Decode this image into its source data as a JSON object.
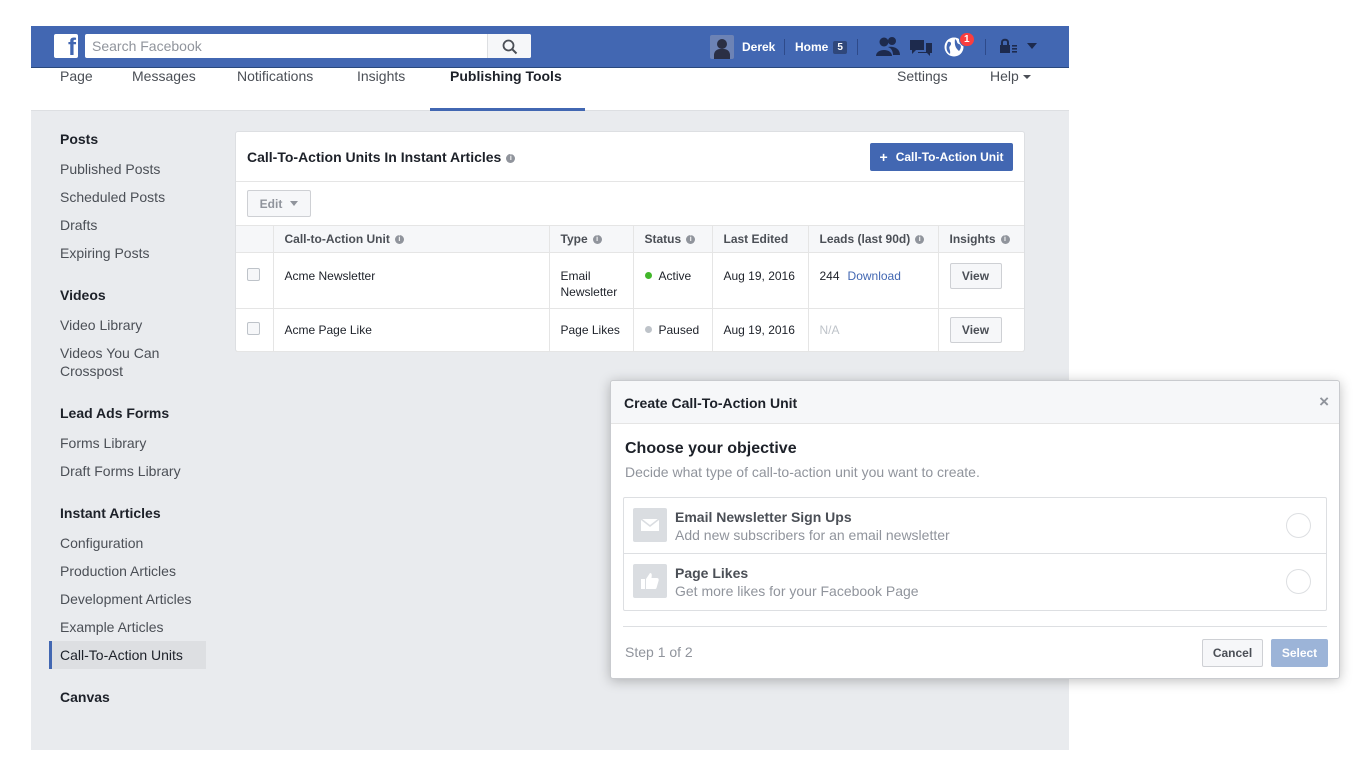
{
  "topbar": {
    "search_placeholder": "Search Facebook",
    "profile_name": "Derek",
    "home_label": "Home",
    "home_count": "5",
    "notifications_count": "1",
    "logo_letter": "f",
    "icons": [
      "facebook-logo",
      "search-icon",
      "friend-requests-icon",
      "messages-icon",
      "notifications-globe-icon",
      "privacy-shortcuts-icon",
      "account-menu-caret-icon"
    ]
  },
  "page_nav": {
    "tabs": [
      {
        "label": "Page"
      },
      {
        "label": "Messages"
      },
      {
        "label": "Notifications"
      },
      {
        "label": "Insights"
      },
      {
        "label": "Publishing Tools",
        "active": true
      }
    ],
    "right": [
      {
        "label": "Settings"
      },
      {
        "label": "Help"
      }
    ]
  },
  "sidebar": {
    "sections": [
      {
        "heading": "Posts",
        "items": [
          "Published Posts",
          "Scheduled Posts",
          "Drafts",
          "Expiring Posts"
        ]
      },
      {
        "heading": "Videos",
        "items": [
          "Video Library",
          "Videos You Can",
          "Crosspost"
        ]
      },
      {
        "heading": "Lead Ads Forms",
        "items": [
          "Forms Library",
          "Draft Forms Library"
        ]
      },
      {
        "heading": "Instant Articles",
        "items": [
          "Configuration",
          "Production Articles",
          "Development Articles",
          "Example Articles",
          "Call-To-Action Units"
        ]
      },
      {
        "heading": "Canvas",
        "items": []
      }
    ],
    "active_item": "Call-To-Action Units"
  },
  "panel": {
    "title": "Call-To-Action Units In Instant Articles",
    "add_button": "Call-To-Action Unit",
    "add_plus": "+",
    "edit_button": "Edit",
    "info_glyph": "i",
    "columns": [
      "Call-to-Action Unit",
      "Type",
      "Status",
      "Last Edited",
      "Leads (last 90d)",
      "Insights"
    ],
    "rows": [
      {
        "name": "Acme Newsletter",
        "type_line1": "Email",
        "type_line2": "Newsletter",
        "status": "Active",
        "status_color": "#42b72a",
        "last_edited": "Aug 19, 2016",
        "leads": "244",
        "leads_link": "Download",
        "insights_button": "View"
      },
      {
        "name": "Acme Page Like",
        "type_line1": "Page Likes",
        "type_line2": "",
        "status": "Paused",
        "status_color": "#bec3c9",
        "last_edited": "Aug 19, 2016",
        "leads": "N/A",
        "leads_link": "",
        "insights_button": "View"
      }
    ]
  },
  "modal": {
    "title": "Create Call-To-Action Unit",
    "close": "×",
    "heading": "Choose your objective",
    "subheading": "Decide what type of call-to-action unit you want to create.",
    "options": [
      {
        "title": "Email Newsletter Sign Ups",
        "desc": "Add new subscribers for an email newsletter",
        "icon": "envelope-icon"
      },
      {
        "title": "Page Likes",
        "desc": "Get more likes for your Facebook Page",
        "icon": "thumbs-up-icon"
      }
    ],
    "step": "Step 1 of 2",
    "cancel": "Cancel",
    "select": "Select"
  },
  "colors": {
    "brand_blue": "#4267b2",
    "page_bg": "#e9ebee",
    "active_green": "#42b72a",
    "badge_red": "#fa3e3e",
    "disabled_blue": "#9cb4d8"
  }
}
